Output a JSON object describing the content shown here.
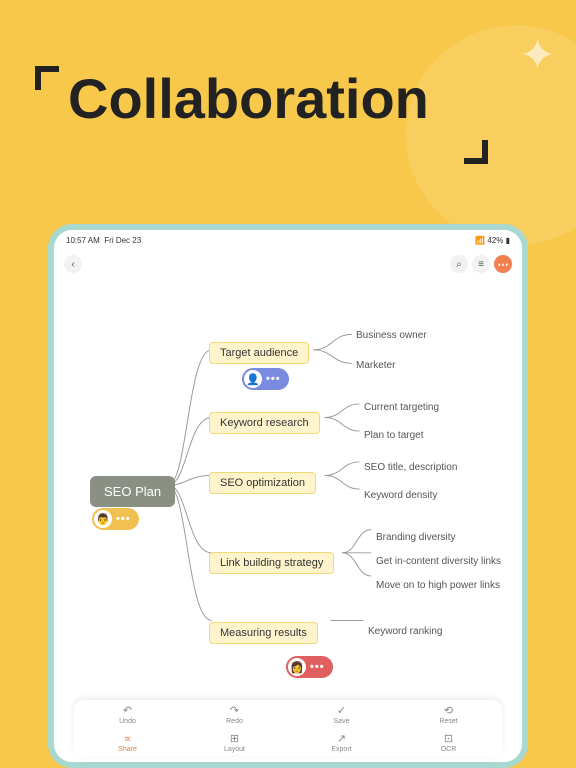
{
  "hero": {
    "title": "Collaboration"
  },
  "statusbar": {
    "time": "10:57 AM",
    "date": "Fri Dec 23",
    "battery": "42%"
  },
  "titlebar": {
    "back": "‹",
    "search": "⌕",
    "list": "≡",
    "more": "⋯"
  },
  "root": {
    "label": "SEO Plan"
  },
  "branches": [
    {
      "label": "Target audience",
      "leaves": [
        "Business owner",
        "Marketer"
      ]
    },
    {
      "label": "Keyword research",
      "leaves": [
        "Current targeting",
        "Plan to target"
      ]
    },
    {
      "label": "SEO optimization",
      "leaves": [
        "SEO title, description",
        "Keyword density"
      ]
    },
    {
      "label": "Link building strategy",
      "leaves": [
        "Branding diversity",
        "Get in-content diversity links",
        "Move on to high power links"
      ]
    },
    {
      "label": "Measuring results",
      "leaves": [
        "Keyword ranking"
      ]
    }
  ],
  "cursors": {
    "blue": "•••",
    "yellow": "•••",
    "red": "•••"
  },
  "toolbar": {
    "row1": [
      {
        "icon": "↶",
        "label": "Undo"
      },
      {
        "icon": "↷",
        "label": "Redo"
      },
      {
        "icon": "✓",
        "label": "Save"
      },
      {
        "icon": "⟲",
        "label": "Reset"
      }
    ],
    "row2": [
      {
        "icon": "∝",
        "label": "Share"
      },
      {
        "icon": "⊞",
        "label": "Layout"
      },
      {
        "icon": "↗",
        "label": "Export"
      },
      {
        "icon": "⊡",
        "label": "OCR"
      }
    ]
  }
}
